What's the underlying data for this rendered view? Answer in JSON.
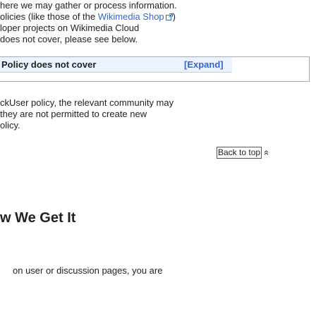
{
  "intro": {
    "line1": "here we may gather or process information.",
    "line2_pre": "olicies (like those of the ",
    "line2_link": "Wikimedia Shop",
    "line2_post": ")",
    "line3": "loper projects on Wikimedia Cloud",
    "line4": "does not cover, please see below."
  },
  "collapsible": {
    "title": "Policy does not cover",
    "toggle": "[Expand]"
  },
  "body": {
    "line1": "ckUser policy, the relevant community may",
    "line2": "they are not permitted to create new",
    "line3": "olicy."
  },
  "back_to_top": {
    "label": "Back to top",
    "arrow": "»"
  },
  "section": {
    "heading": "w We Get It"
  },
  "footer": {
    "line1": "on user or discussion pages, you are"
  },
  "colors": {
    "link": "#3366cc",
    "header_bg": "#eaf3ff",
    "border": "#a2a9b1"
  }
}
